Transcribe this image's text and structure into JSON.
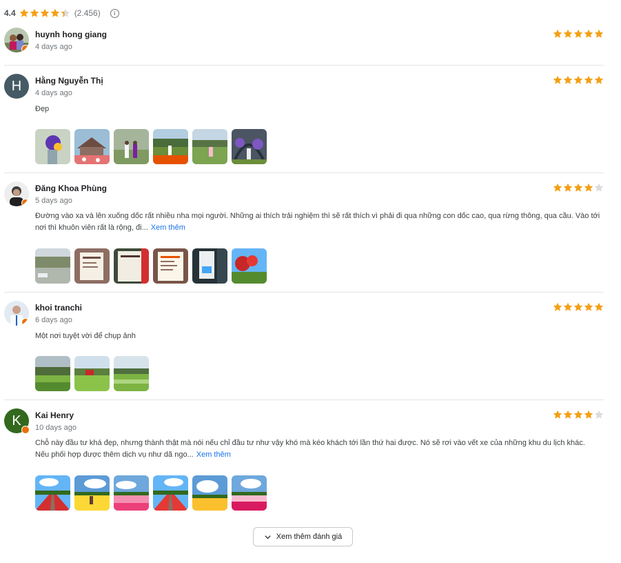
{
  "summary": {
    "score": "4.4",
    "count": "(2.456)",
    "stars": 4.4,
    "info_icon": "info-icon"
  },
  "colors": {
    "star": "#f4a015",
    "star_empty": "#dcdcdc",
    "link": "#1a73e8",
    "badge": "#e8710a"
  },
  "reviews": [
    {
      "name": "huynh hong giang",
      "date": "4 days ago",
      "stars": 5,
      "text": "",
      "more": "",
      "photos": []
    },
    {
      "name": "Hằng Nguyễn Thị",
      "date": "4 days ago",
      "stars": 5,
      "text": "Đẹp",
      "more": "",
      "avatar_letter": "H",
      "avatar_color": "#455a64",
      "photos": [
        "flower-bouquet",
        "wooden-cabin",
        "garden-couple",
        "flower-field",
        "grass-hill",
        "arch-path"
      ]
    },
    {
      "name": "Đăng Khoa Phùng",
      "date": "5 days ago",
      "stars": 4,
      "text": "Đường vào xa và lên xuống dốc rất nhiều nha mọi người. Những ai thích trải nghiệm thì sẽ rất thích vì phải đi qua những con dốc cao, qua rừng thông, qua cầu. Vào tới nơi thì khuôn viên rất là rộng, đi...",
      "more": "Xem thêm",
      "photos": [
        "road-view",
        "price-board",
        "menu-photo",
        "ticket-list",
        "info-sign",
        "red-tree"
      ]
    },
    {
      "name": "khoi tranchi",
      "date": "6 days ago",
      "stars": 5,
      "text": "Một nơi tuyệt vời để chụp ảnh",
      "more": "",
      "photos": [
        "valley-field",
        "farm-house",
        "green-meadow"
      ]
    },
    {
      "name": "Kai Henry",
      "date": "10 days ago",
      "stars": 4,
      "text": "Chỗ này đầu tư khá đẹp, nhưng thành thật mà nói nếu chỉ đầu tư như vậy khó mà kéo khách tới lần thứ hai được. Nó sẽ rơi vào vết xe của những khu du lịch khác. Nếu phối hợp được thêm dịch vụ như dã ngo...",
      "more": "Xem thêm",
      "avatar_letter": "K",
      "avatar_color": "#33691e",
      "photos": [
        "red-flowers",
        "yellow-flowers",
        "pink-flowers",
        "red-flowers-2",
        "yellow-flowers-2",
        "pink-flowers-2"
      ]
    }
  ],
  "load_more": "Xem thêm đánh giá"
}
